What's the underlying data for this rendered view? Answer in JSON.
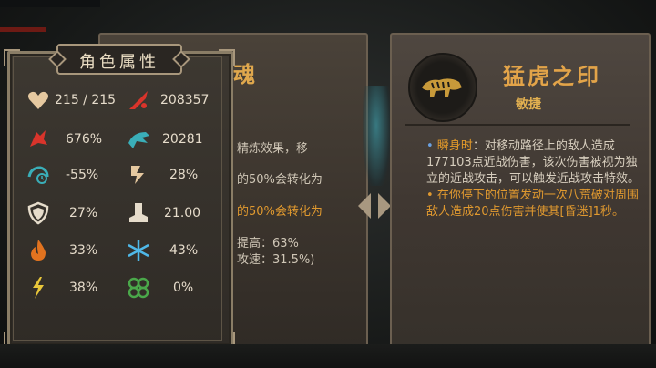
{
  "stats_panel": {
    "title": "角色属性",
    "stats": [
      {
        "icon": "heart-icon",
        "value": "215 / 215",
        "color": "#e6c9a0"
      },
      {
        "icon": "sword-attack-icon",
        "value": "208357",
        "color": "#d9342b"
      },
      {
        "icon": "crit-chance-icon",
        "value": "676%",
        "color": "#d9342b"
      },
      {
        "icon": "crit-damage-icon",
        "value": "20281",
        "color": "#3aaeb8"
      },
      {
        "icon": "cooldown-icon",
        "value": "-55%",
        "color": "#3aaeb8"
      },
      {
        "icon": "burst-icon",
        "value": "28%",
        "color": "#e6c9a0"
      },
      {
        "icon": "shield-icon",
        "value": "27%",
        "color": "#e6dccb"
      },
      {
        "icon": "boot-icon",
        "value": "21.00",
        "color": "#e6dccb"
      },
      {
        "icon": "fire-icon",
        "value": "33%",
        "color": "#e2731f"
      },
      {
        "icon": "snowflake-icon",
        "value": "43%",
        "color": "#4fb8e8"
      },
      {
        "icon": "lightning-icon",
        "value": "38%",
        "color": "#e8c63a"
      },
      {
        "icon": "poison-icon",
        "value": "0%",
        "color": "#4aa84a"
      }
    ]
  },
  "middle_panel": {
    "title": "魂",
    "lines": [
      {
        "text": "精炼效果，移",
        "orange": false
      },
      {
        "text": "的50%会转化为",
        "orange": false
      },
      {
        "text": "的50%会转化为",
        "orange": true
      },
      {
        "text": "提高：63%",
        "orange": false
      },
      {
        "text": "攻速：31.5%)",
        "orange": false
      }
    ]
  },
  "right_panel": {
    "title": "猛虎之印",
    "subtitle": "敏捷",
    "effect1_name": "瞬身时",
    "effect1_text": "：对移动路径上的敌人造成177103点近战伤害，该次伤害被视为独立的近战攻击，可以触发近战攻击特效。",
    "effect2_text": "在你停下的位置发动一次八荒破对周围敌人造成20点伤害并使其[昏迷]1秒。",
    "bullet": "•"
  }
}
